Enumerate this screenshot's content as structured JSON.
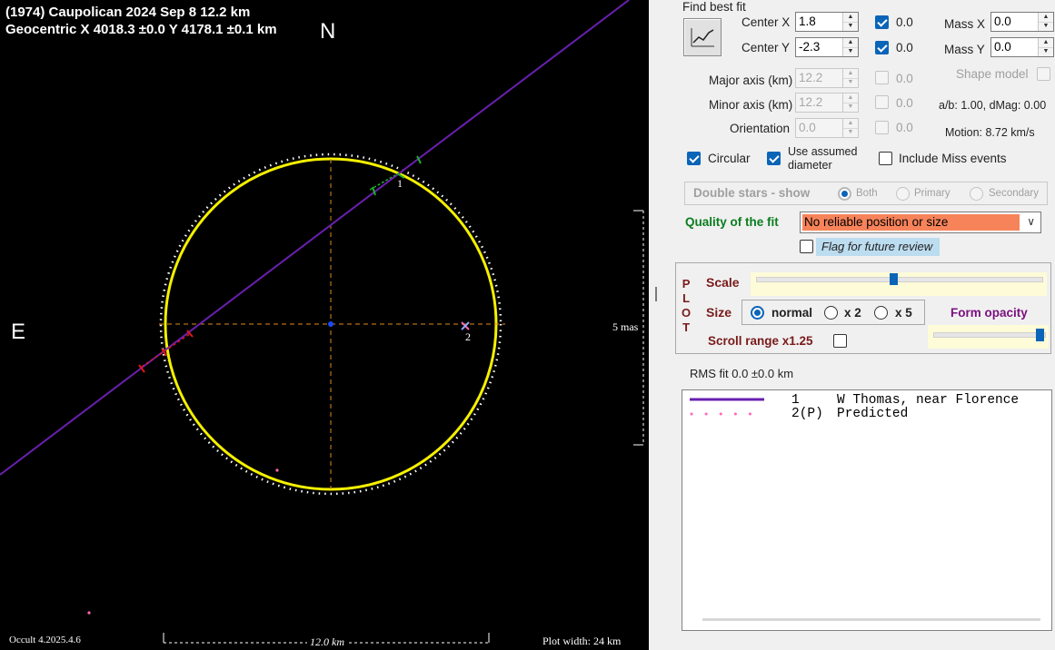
{
  "plot": {
    "title_line1": "(1974) Caupolican  2024 Sep 8   12.2 km",
    "title_line2": "Geocentric  X  4018.3 ±0.0  Y 4178.1 ±0.1 km",
    "north_label": "N",
    "east_label": "E",
    "scale_right_label": "5 mas",
    "scale_bottom_label": "12.0 km",
    "version_label": "Occult 4.2025.4.6",
    "plot_width_label": "Plot width: 24 km",
    "chord_label_1": "1",
    "chord_label_2": "2",
    "colors": {
      "background": "#000000",
      "ellipse": "#f5f000",
      "chord": "#6a1fb0",
      "axes": "#e08a1e",
      "predicted": "#ff69b4"
    }
  },
  "panel": {
    "find_best_fit": "Find best fit",
    "find_best_fit_icon": "line-chart-icon",
    "center_x_label": "Center X",
    "center_x_value": "1.8",
    "center_x_chk_label": "0.0",
    "center_y_label": "Center Y",
    "center_y_value": "-2.3",
    "center_y_chk_label": "0.0",
    "mass_x_label": "Mass X",
    "mass_x_value": "0.0",
    "mass_y_label": "Mass Y",
    "mass_y_value": "0.0",
    "major_label": "Major axis (km)",
    "major_value": "12.2",
    "major_chk_label": "0.0",
    "minor_label": "Minor axis (km)",
    "minor_value": "12.2",
    "minor_chk_label": "0.0",
    "orient_label": "Orientation",
    "orient_value": "0.0",
    "orient_chk_label": "0.0",
    "shape_model": "Shape model",
    "ab_info": "a/b: 1.00, dMag: 0.00",
    "motion": "Motion: 8.72 km/s",
    "circular": "Circular",
    "use_assumed_1": "Use assumed",
    "use_assumed_2": "diameter",
    "include_miss": "Include Miss events",
    "double_stars": "Double stars - show",
    "both": "Both",
    "primary": "Primary",
    "secondary": "Secondary",
    "quality_label": "Quality of the fit",
    "quality_value": "No reliable position or size",
    "flag_review": "Flag for future review",
    "plot_vertical": [
      "P",
      "L",
      "O",
      "T"
    ],
    "scale_label": "Scale",
    "size_label": "Size",
    "size_normal": "normal",
    "size_x2": "x 2",
    "size_x5": "x 5",
    "form_opacity": "Form opacity",
    "scroll_range": "Scroll range x1.25",
    "rms_fit": "RMS fit 0.0 ±0.0 km",
    "slider_values": {
      "scale": 0.48,
      "opacity": 0.96
    }
  },
  "legend": {
    "rows": [
      {
        "id": "1",
        "name": "W Thomas, near Florence",
        "style": "solid",
        "color": "#6a1fb0"
      },
      {
        "id": "2(P)",
        "name": "Predicted",
        "style": "dotted",
        "color": "#ff69b4"
      }
    ]
  }
}
